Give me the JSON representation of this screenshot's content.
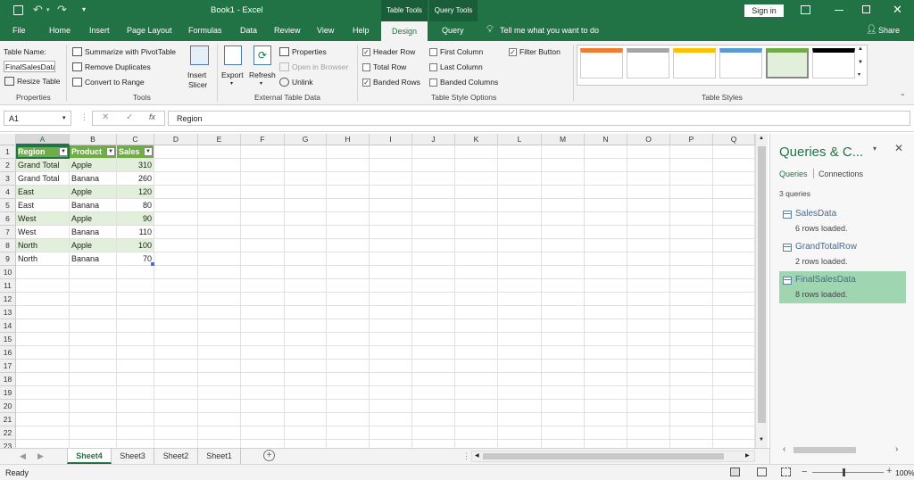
{
  "app": {
    "title": "Book1  -  Excel",
    "signin": "Sign in",
    "context_tab_table": "Table Tools",
    "context_tab_query": "Query Tools"
  },
  "tabs": [
    "File",
    "Home",
    "Insert",
    "Page Layout",
    "Formulas",
    "Data",
    "Review",
    "View",
    "Help",
    "Design",
    "Query"
  ],
  "tell_me": "Tell me what you want to do",
  "share": "Share",
  "ribbon": {
    "table_name_label": "Table Name:",
    "table_name_value": "FinalSalesData",
    "resize_table": "Resize Table",
    "group_properties": "Properties",
    "summarize": "Summarize with PivotTable",
    "remove_duplicates": "Remove Duplicates",
    "convert_range": "Convert to Range",
    "group_tools": "Tools",
    "insert_slicer": "Insert Slicer",
    "insert_slicer_1": "Insert",
    "insert_slicer_2": "Slicer",
    "export": "Export",
    "refresh": "Refresh",
    "properties": "Properties",
    "open_browser": "Open in Browser",
    "unlink": "Unlink",
    "group_external": "External Table Data",
    "header_row": "Header Row",
    "total_row": "Total Row",
    "banded_rows": "Banded Rows",
    "first_column": "First Column",
    "last_column": "Last Column",
    "banded_columns": "Banded Columns",
    "filter_button": "Filter Button",
    "group_style_options": "Table Style Options",
    "group_table_styles": "Table Styles",
    "style_colors": [
      "#ed7d31",
      "#a5a5a5",
      "#ffc000",
      "#5b9bd5",
      "#70ad47",
      "#000000"
    ]
  },
  "formula": {
    "name_box": "A1",
    "fx": "fx",
    "content": "Region"
  },
  "columns": [
    "A",
    "B",
    "C",
    "D",
    "E",
    "F",
    "G",
    "H",
    "I",
    "J",
    "K",
    "L",
    "M",
    "N",
    "O",
    "P",
    "Q"
  ],
  "rows": [
    "1",
    "2",
    "3",
    "4",
    "5",
    "6",
    "7",
    "8",
    "9",
    "10",
    "11",
    "12",
    "13",
    "14",
    "15",
    "16",
    "17",
    "18",
    "19",
    "20",
    "21",
    "22",
    "23"
  ],
  "table": {
    "headers": [
      "Region",
      "Product",
      "Sales"
    ],
    "rows": [
      [
        "Grand Total",
        "Apple",
        "310"
      ],
      [
        "Grand Total",
        "Banana",
        "260"
      ],
      [
        "East",
        "Apple",
        "120"
      ],
      [
        "East",
        "Banana",
        "80"
      ],
      [
        "West",
        "Apple",
        "90"
      ],
      [
        "West",
        "Banana",
        "110"
      ],
      [
        "North",
        "Apple",
        "100"
      ],
      [
        "North",
        "Banana",
        "70"
      ]
    ]
  },
  "sheets": [
    "Sheet4",
    "Sheet3",
    "Sheet2",
    "Sheet1"
  ],
  "active_sheet": "Sheet4",
  "status": {
    "ready": "Ready",
    "zoom": "100%"
  },
  "pane": {
    "title": "Queries & C...",
    "tab_queries": "Queries",
    "tab_connections": "Connections",
    "count": "3 queries",
    "queries": [
      {
        "name": "SalesData",
        "status": "6 rows loaded."
      },
      {
        "name": "GrandTotalRow",
        "status": "2 rows loaded."
      },
      {
        "name": "FinalSalesData",
        "status": "8 rows loaded."
      }
    ]
  }
}
